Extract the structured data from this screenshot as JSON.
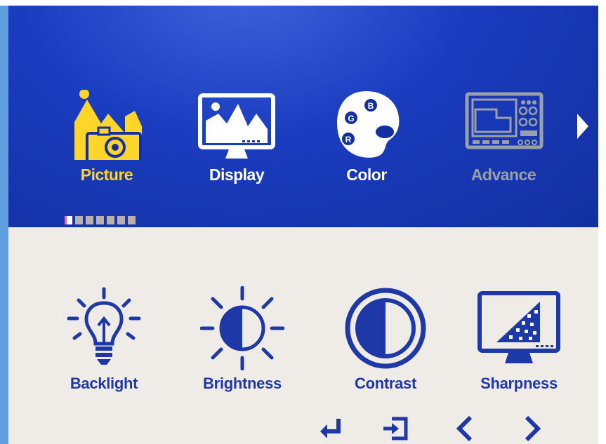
{
  "categories": [
    {
      "label": "Picture",
      "icon": "picture-icon",
      "state": "selected"
    },
    {
      "label": "Display",
      "icon": "display-icon",
      "state": "normal"
    },
    {
      "label": "Color",
      "icon": "color-palette-icon",
      "state": "normal"
    },
    {
      "label": "Advance",
      "icon": "advance-icon",
      "state": "disabled"
    }
  ],
  "palette_letters": {
    "g": "G",
    "b": "B",
    "r": "R"
  },
  "page_indicator": {
    "current": 1,
    "total": 7
  },
  "items": [
    {
      "label": "Backlight",
      "icon": "lightbulb-icon"
    },
    {
      "label": "Brightness",
      "icon": "sun-icon"
    },
    {
      "label": "Contrast",
      "icon": "contrast-icon"
    },
    {
      "label": "Sharpness",
      "icon": "sharpness-monitor-icon"
    }
  ],
  "nav_icons": [
    "enter-icon",
    "exit-icon",
    "left-arrow-icon",
    "right-arrow-icon"
  ],
  "colors": {
    "header_blue": "#1a3cbf",
    "selected_yellow": "#ffd52a",
    "disabled_gray": "#9aa0a8",
    "item_blue": "#1e38a8",
    "panel_bg": "#efece8"
  }
}
